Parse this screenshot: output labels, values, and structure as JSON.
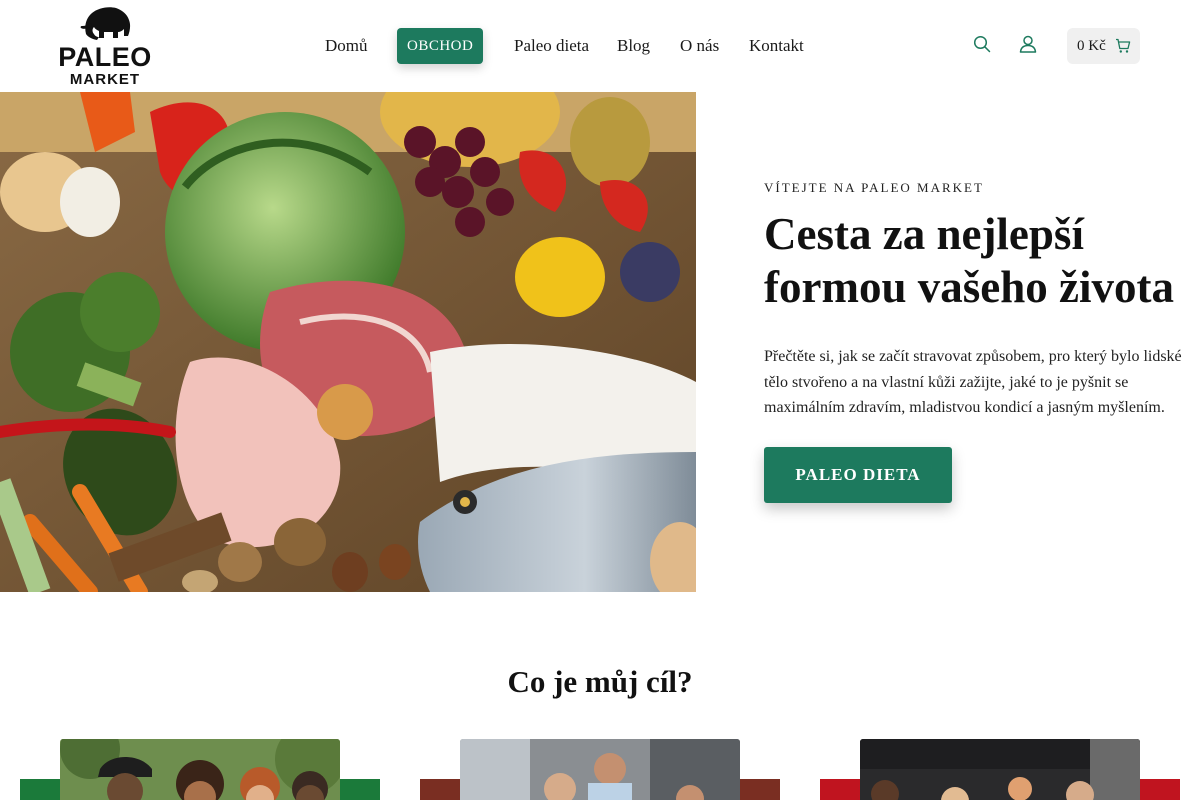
{
  "header": {
    "logo": {
      "line1": "PALEO",
      "line2": "MARKET"
    },
    "nav": [
      {
        "label": "Domů"
      },
      {
        "label": "OBCHOD",
        "active": true
      },
      {
        "label": "Paleo dieta"
      },
      {
        "label": "Blog"
      },
      {
        "label": "O nás"
      },
      {
        "label": "Kontakt"
      }
    ],
    "icons": {
      "search": "search-icon",
      "account": "user-icon",
      "cart": "cart-icon"
    },
    "cart_total": "0 Kč"
  },
  "hero": {
    "eyebrow": "VÍTEJTE NA PALEO MARKET",
    "title": "Cesta za nejlepší formou vašeho života",
    "description": "Přečtěte si, jak se začít stravovat způsobem, pro který bylo lidské tělo stvořeno a na vlastní kůži zažijte, jaké to je pyšnit se maximálním zdravím, mladistvou kondicí a jasným myšlením.",
    "cta": "PALEO DIETA"
  },
  "goals": {
    "title": "Co je můj cíl?"
  },
  "colors": {
    "accent": "#1d7a5e",
    "card_green": "#1b7a3a",
    "card_brown": "#7a2e22",
    "card_red": "#c0141f"
  }
}
